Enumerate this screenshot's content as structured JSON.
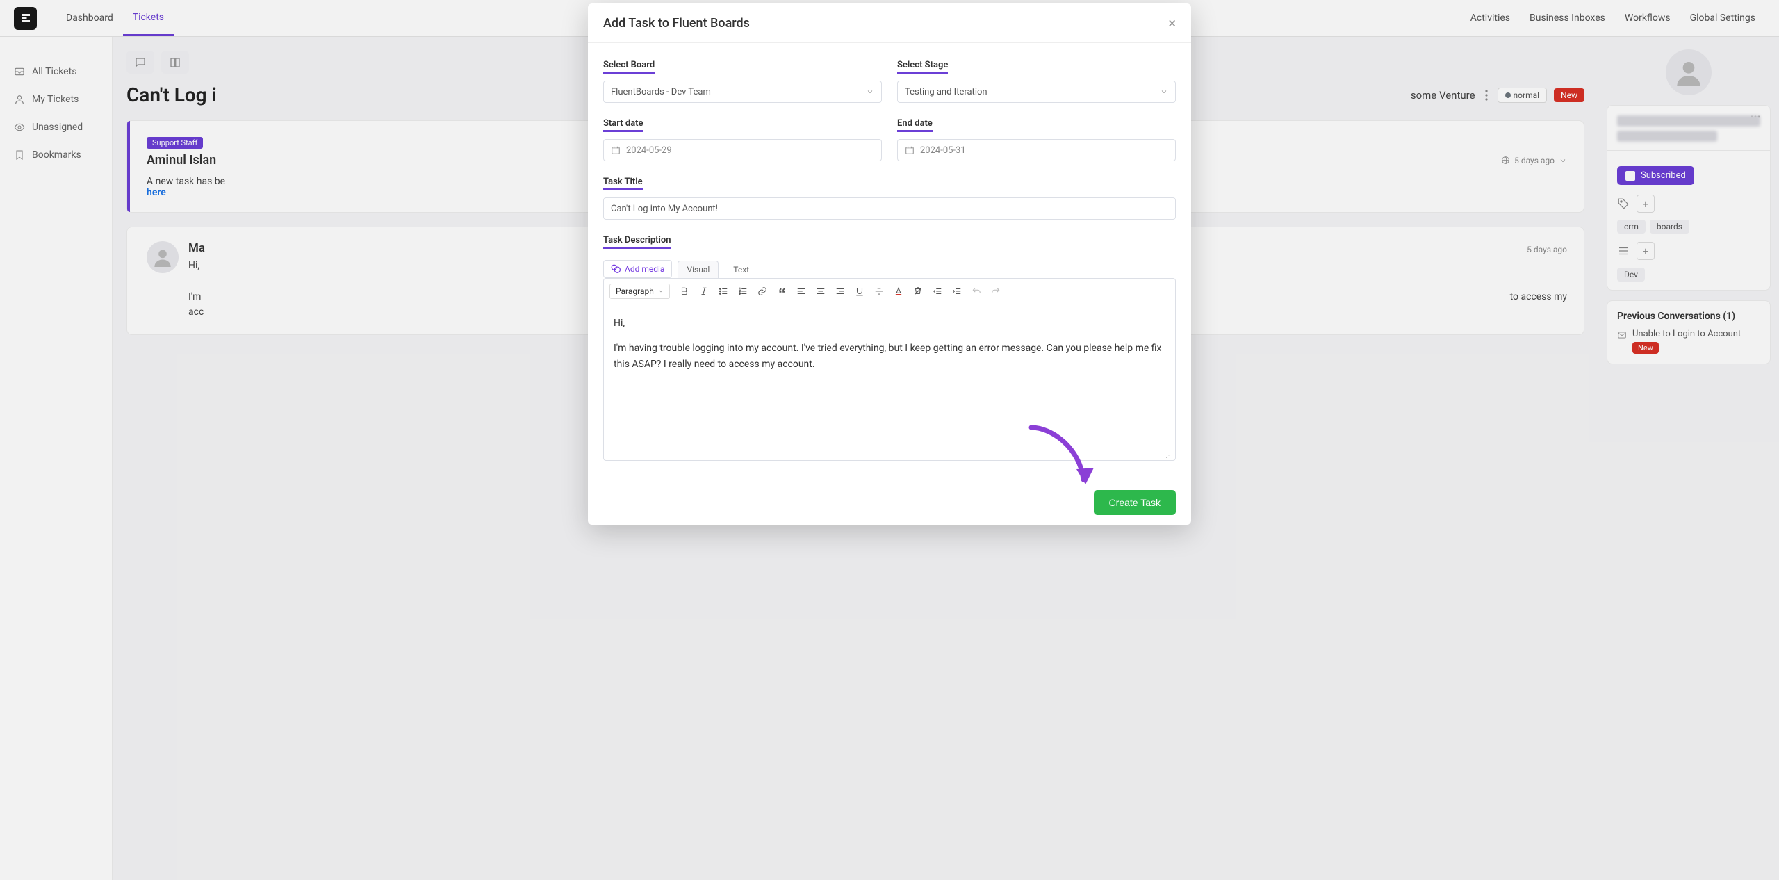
{
  "topnav": {
    "items": [
      "Dashboard",
      "Tickets",
      "",
      "",
      "",
      "",
      "",
      "Activities",
      "Business Inboxes",
      "Workflows",
      "Global Settings"
    ],
    "active_index": 1
  },
  "sidebar": {
    "items": [
      {
        "label": "All Tickets"
      },
      {
        "label": "My Tickets"
      },
      {
        "label": "Unassigned"
      },
      {
        "label": "Bookmarks"
      }
    ]
  },
  "ticket": {
    "title": "Can't Log i",
    "venture": "some Venture",
    "priority_label": "normal",
    "status_label": "New"
  },
  "card1": {
    "pill": "Support Staff",
    "author": "Aminul Islan",
    "time": "5 days ago",
    "body_prefix": "A new task has be",
    "body_link": "here"
  },
  "card2": {
    "author": "Ma",
    "time": "5 days ago",
    "line1": "Hi,",
    "line2_prefix": "I'm ",
    "line2_suffix": "to access my",
    "line3": "acc"
  },
  "right_panel": {
    "subscribed_label": "Subscribed",
    "tags": [
      "crm",
      "boards"
    ],
    "dev_tag": "Dev",
    "prev_conv_title": "Previous Conversations (1)",
    "prev_conv_item": "Unable to Login to Account",
    "prev_conv_status": "New"
  },
  "modal": {
    "title": "Add Task to Fluent Boards",
    "labels": {
      "select_board": "Select Board",
      "select_stage": "Select Stage",
      "start_date": "Start date",
      "end_date": "End date",
      "task_title": "Task Title",
      "task_description": "Task Description"
    },
    "select_board_value": "FluentBoards - Dev Team",
    "select_stage_value": "Testing and Iteration",
    "start_date_value": "2024-05-29",
    "end_date_value": "2024-05-31",
    "task_title_value": "Can't Log into My Account!",
    "editor": {
      "add_media": "Add media",
      "tabs": [
        "Visual",
        "Text"
      ],
      "paragraph_label": "Paragraph",
      "content_p1": "Hi,",
      "content_p2": "I'm having trouble logging into my account. I've tried everything, but I keep getting an error message. Can you please help me fix this ASAP? I really need to access my account."
    },
    "create_btn": "Create Task"
  },
  "colors": {
    "accent": "#6b3fd6",
    "success": "#2db84c",
    "danger": "#d93025"
  }
}
